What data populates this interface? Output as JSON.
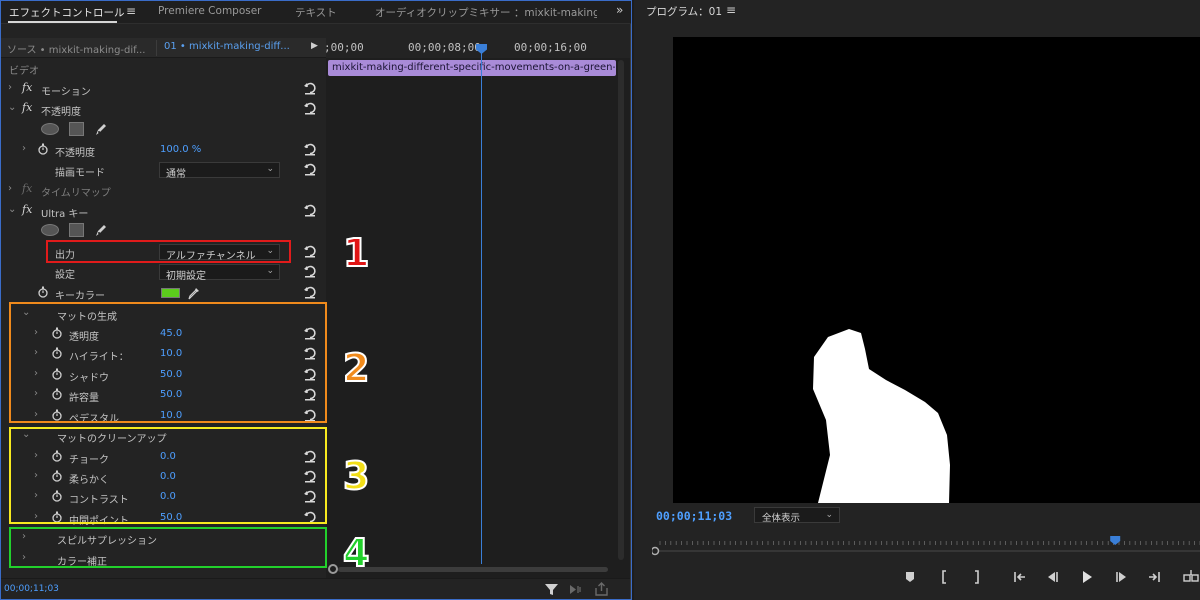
{
  "effect_controls": {
    "tabs": [
      {
        "label": "エフェクトコントロール",
        "active": true
      },
      {
        "label": "Premiere Composer",
        "active": false
      },
      {
        "label": "テキスト",
        "active": false
      },
      {
        "label": "オーディオクリップミキサー ：mixkit-making-d",
        "active": false
      }
    ],
    "menu_icon": "≡",
    "overflow_icon": "»",
    "source_tab": "ソース • mixkit-making-dif...",
    "sequence_tab": "01 • mixkit-making-diff...",
    "section_video": "ビデオ",
    "motion": "モーション",
    "opacity": "不透明度",
    "opacity_param": "不透明度",
    "opacity_value": "100.0 %",
    "blend_mode_label": "描画モード",
    "blend_mode_value": "通常",
    "time_remap": "タイムリマップ",
    "ultra_key": "Ultra キー",
    "output_label": "出力",
    "output_value": "アルファチャンネル",
    "setting_label": "設定",
    "setting_value": "初期設定",
    "key_color_label": "キーカラー",
    "key_color": "#5ccc1c",
    "matte_generation": "マットの生成",
    "transparency_label": "透明度",
    "transparency_value": "45.0",
    "highlight_label": "ハイライト：",
    "highlight_value": "10.0",
    "shadow_label": "シャドウ",
    "shadow_value": "50.0",
    "tolerance_label": "許容量",
    "tolerance_value": "50.0",
    "pedestal_label": "ペデスタル",
    "pedestal_value": "10.0",
    "matte_cleanup": "マットのクリーンアップ",
    "choke_label": "チョーク",
    "choke_value": "0.0",
    "soften_label": "柔らかく",
    "soften_value": "0.0",
    "contrast_label": "コントラスト",
    "contrast_value": "0.0",
    "midpoint_label": "中間ポイント",
    "midpoint_value": "50.0",
    "spill_suppression": "スピルサプレッション",
    "color_correction": "カラー補正",
    "footer_timecode": "00;00;11;03"
  },
  "timeline": {
    "ticks": [
      ";00;00",
      "00;00;08;00",
      "00;00;16;00"
    ],
    "clip_name": "mixkit-making-different-specific-movements-on-a-green-ba"
  },
  "annotations": {
    "n1": "1",
    "n2": "2",
    "n3": "3",
    "n4": "4",
    "colors": {
      "n1": "#e01515",
      "n2": "#f08a1c",
      "n3": "#f2de18",
      "n4": "#22d02c"
    }
  },
  "program": {
    "title": "プログラム：01",
    "menu_icon": "≡",
    "timecode": "00;00;11;03",
    "fit_value": "全体表示",
    "playhead_fraction": 0.85
  }
}
